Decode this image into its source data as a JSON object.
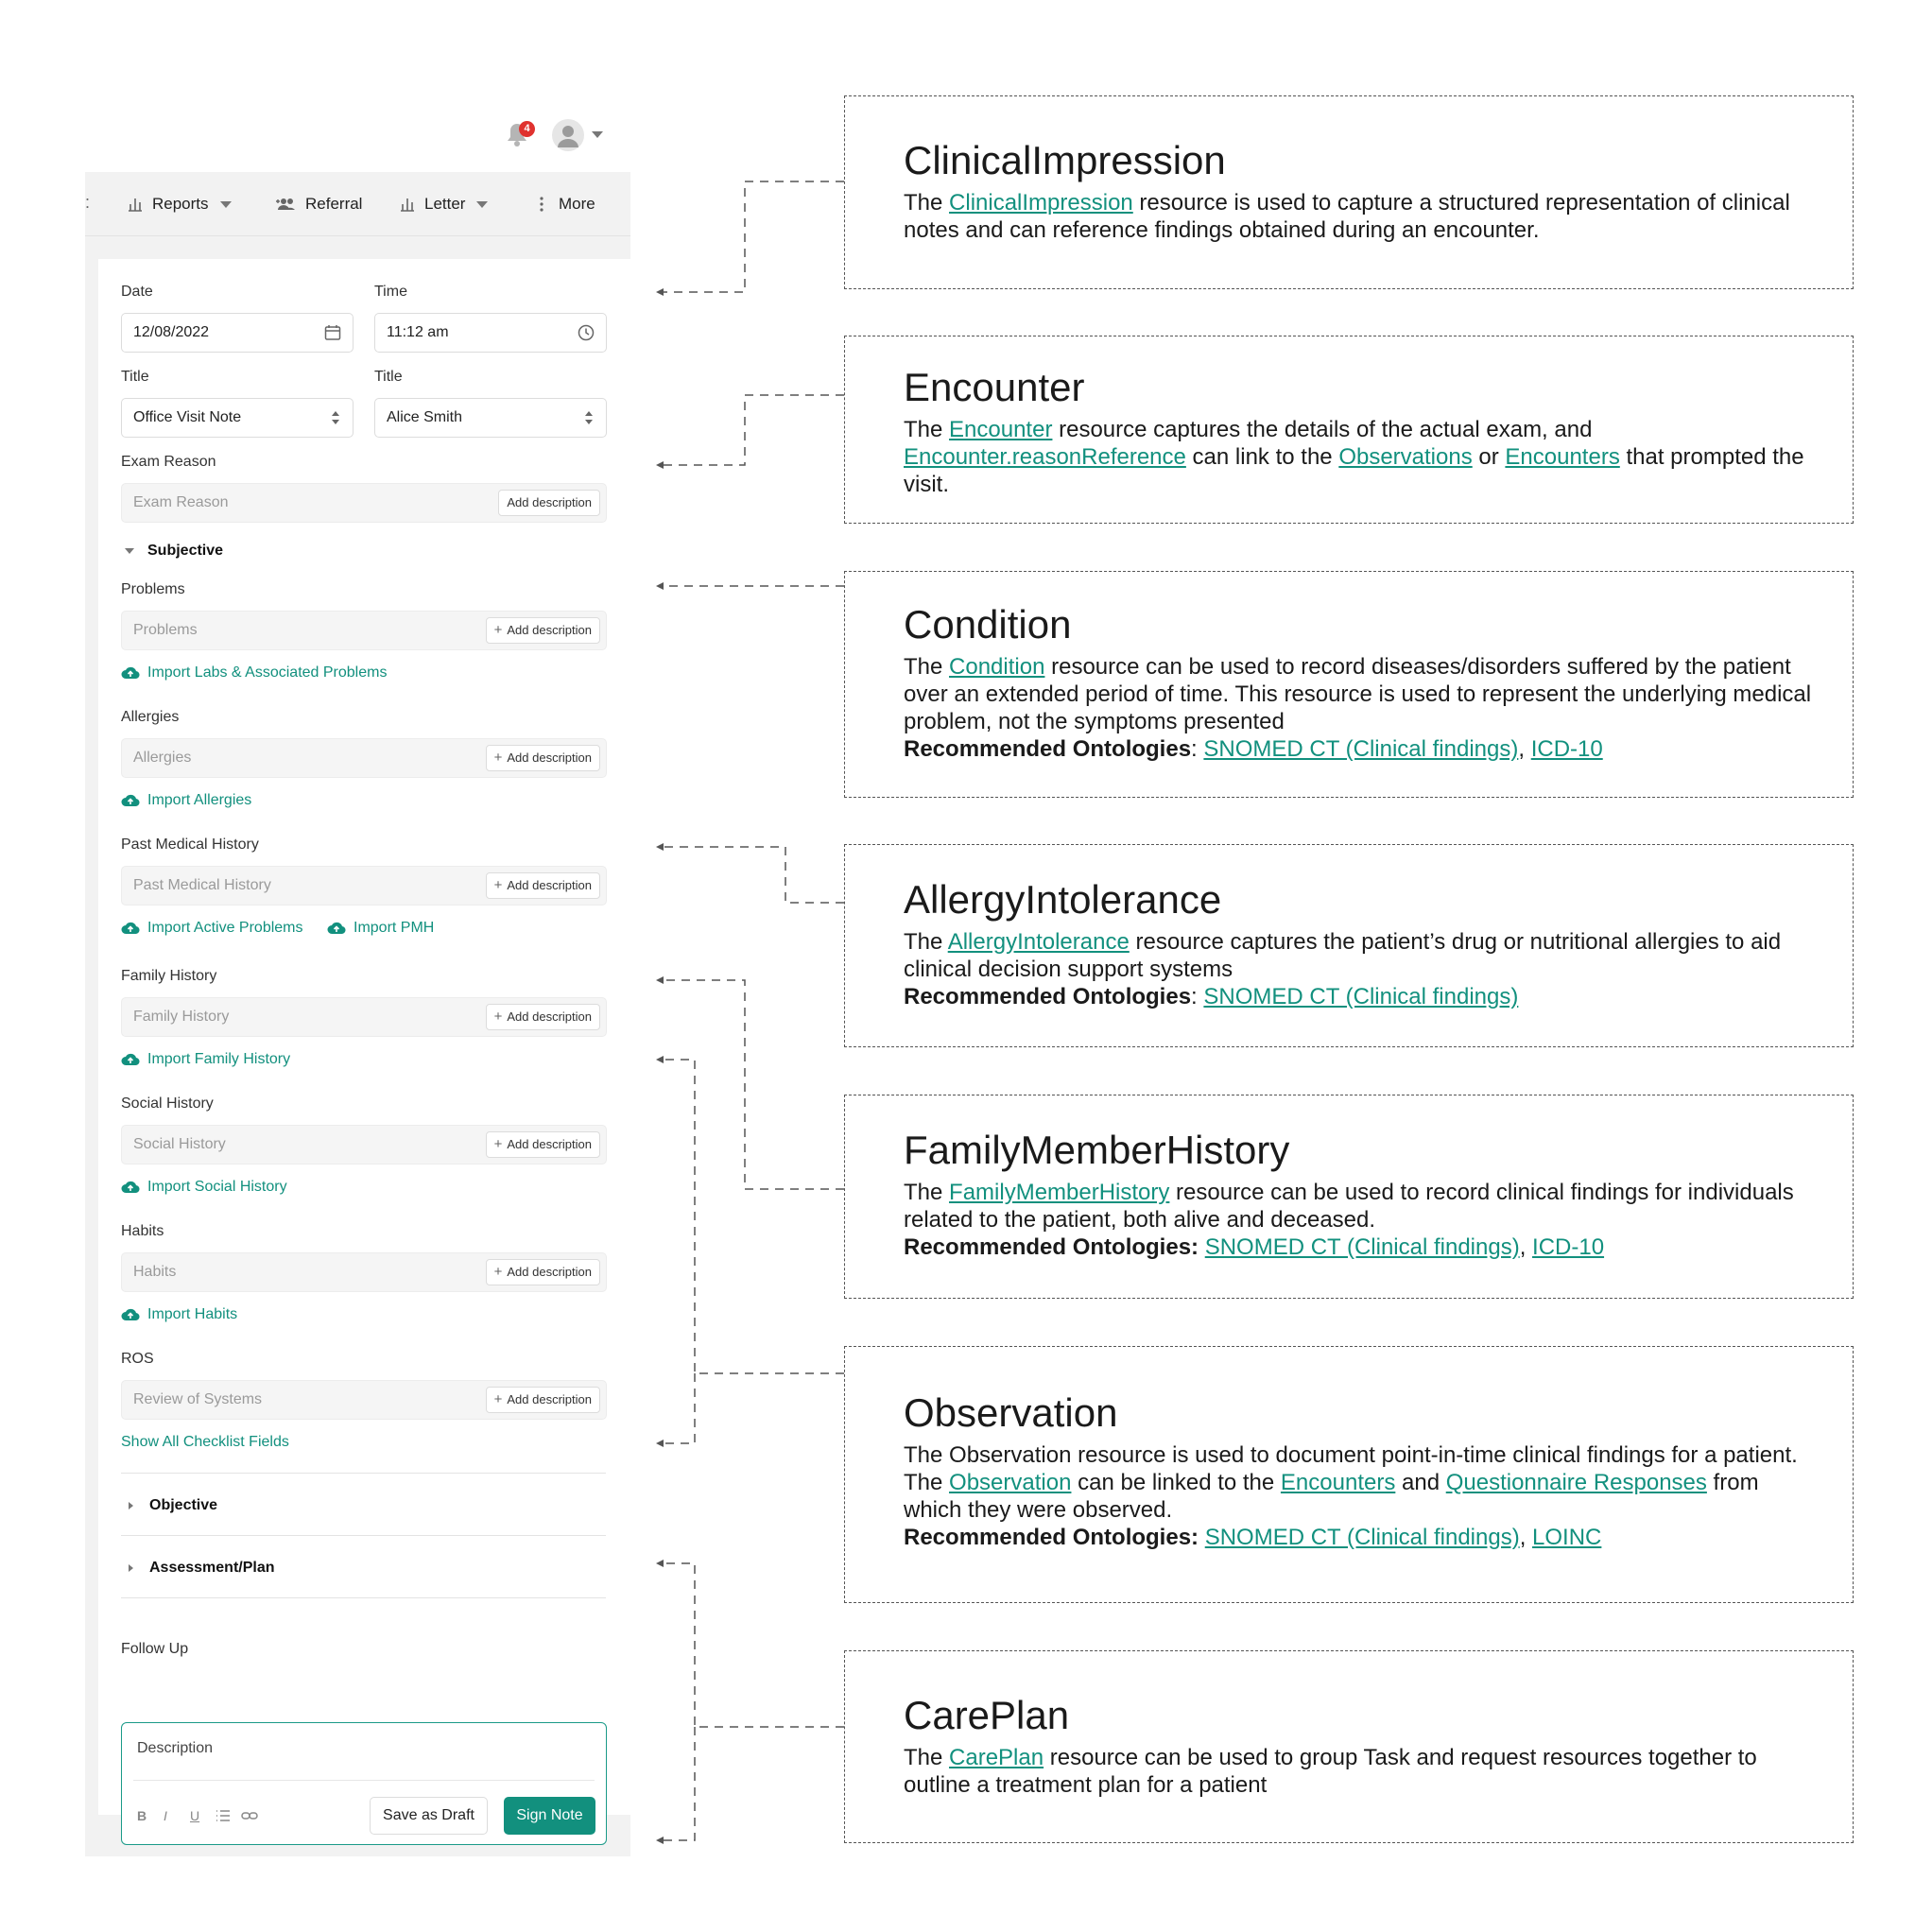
{
  "header": {
    "notification_count": "4"
  },
  "toolbar": {
    "reports": "Reports",
    "referral": "Referral",
    "letter": "Letter",
    "more": "More"
  },
  "form": {
    "date_label": "Date",
    "date_value": "12/08/2022",
    "time_label": "Time",
    "time_value": "11:12 am",
    "title_label": "Title",
    "title_value": "Office Visit Note",
    "title2_label": "Title",
    "title2_value": "Alice Smith",
    "exam_reason_label": "Exam Reason",
    "exam_reason_placeholder": "Exam Reason",
    "add_description": "Add description",
    "subjective": "Subjective",
    "problems_label": "Problems",
    "problems_placeholder": "Problems",
    "import_labs": "Import Labs & Associated Problems",
    "allergies_label": "Allergies",
    "allergies_placeholder": "Allergies",
    "import_allergies": "Import Allergies",
    "pmh_label": "Past Medical History",
    "pmh_placeholder": "Past Medical History",
    "import_active_problems": "Import Active Problems",
    "import_pmh": "Import PMH",
    "family_label": "Family History",
    "family_placeholder": "Family History",
    "import_family": "Import Family History",
    "social_label": "Social History",
    "social_placeholder": "Social History",
    "import_social": "Import Social History",
    "habits_label": "Habits",
    "habits_placeholder": "Habits",
    "import_habits": "Import Habits",
    "ros_label": "ROS",
    "ros_placeholder": "Review of Systems",
    "show_all": "Show All Checklist Fields",
    "objective": "Objective",
    "assessment": "Assessment/Plan",
    "followup_label": "Follow Up",
    "followup_placeholder": "Description",
    "fmt_bold": "B",
    "fmt_italic": "I",
    "fmt_underline": "U",
    "save_draft": "Save as Draft",
    "sign_note": "Sign Note"
  },
  "annotations": {
    "clinical": {
      "title": "ClinicalImpression",
      "t1": "The ",
      "l1": "ClinicalImpression",
      "t2": " resource is used to capture a structured representation of clinical notes and can reference findings obtained during an encounter."
    },
    "encounter": {
      "title": "Encounter",
      "t1": "The ",
      "l1": "Encounter",
      "t2": " resource captures the details of the actual exam, and ",
      "l2": "Encounter.reasonReference",
      "t3": " can link to the ",
      "l3": "Observations",
      "t4": " or ",
      "l4": "Encounters",
      "t5": " that prompted the visit."
    },
    "condition": {
      "title": "Condition",
      "t1": "The ",
      "l1": "Condition",
      "t2": " resource can be used to record diseases/disorders suffered by the patient over an extended period of time. This resource is used to represent the underlying medical problem, not the symptoms presented",
      "rec": "Recommended Ontologies",
      "colon": ": ",
      "l2": "SNOMED CT (Clinical findings)",
      "comma": ", ",
      "l3": "ICD-10"
    },
    "allergy": {
      "title": "AllergyIntolerance",
      "t1": "The ",
      "l1": "AllergyIntolerance",
      "t2": " resource captures the patient’s drug or nutritional allergies to aid clinical decision support systems",
      "rec": "Recommended Ontologies",
      "colon": ": ",
      "l2": "SNOMED CT (Clinical findings)"
    },
    "family": {
      "title": "FamilyMemberHistory",
      "t1": "The ",
      "l1": "FamilyMemberHistory",
      "t2": " resource can be used to record clinical findings for individuals related to the patient, both alive and deceased.",
      "rec": "Recommended Ontologies:",
      "space": " ",
      "l2": "SNOMED CT (Clinical findings)",
      "comma": ", ",
      "l3": "ICD-10"
    },
    "observation": {
      "title": "Observation",
      "t1": "The Observation resource is used to document point-in-time clinical findings for a patient. The ",
      "l1": "Observation",
      "t2": " can be linked to the ",
      "l2": "Encounters",
      "t3": " and ",
      "l3": "Questionnaire Responses",
      "t4": " from which they were observed.",
      "rec": "Recommended Ontologies:",
      "space": " ",
      "l4": "SNOMED CT (Clinical findings)",
      "comma": ", ",
      "l5": "LOINC"
    },
    "careplan": {
      "title": "CarePlan",
      "t1": "The ",
      "l1": "CarePlan",
      "t2": " resource can be used to group Task and request resources together to outline a treatment plan for a patient"
    }
  }
}
